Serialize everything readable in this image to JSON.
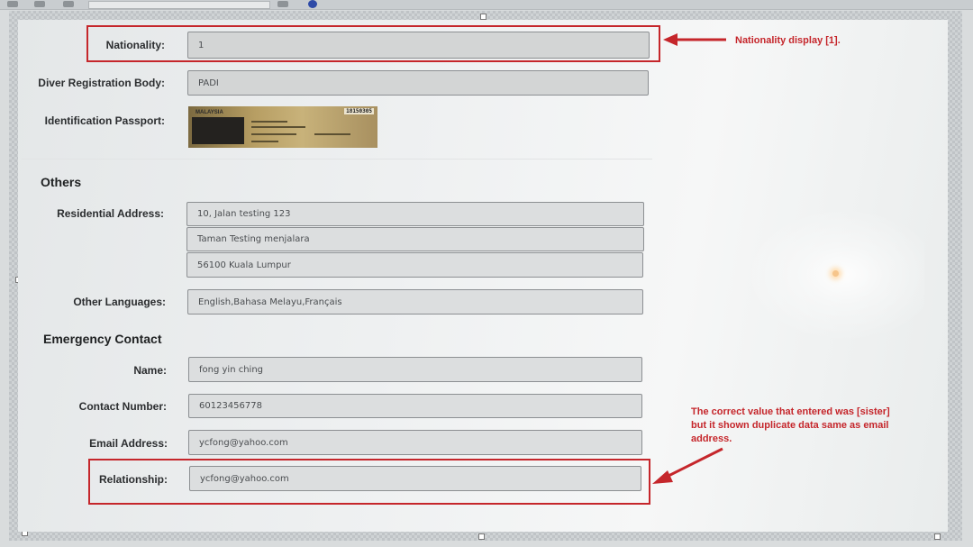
{
  "colors": {
    "annotation_red": "#c5262b",
    "field_bg": "#d3d5d5",
    "field_border": "#8c8f92",
    "page_bg": "#eef0f1"
  },
  "profile": {
    "nationality": {
      "label": "Nationality:",
      "value": "1"
    },
    "diver_registration_body": {
      "label": "Diver Registration Body:",
      "value": "PADI"
    },
    "identification_passport": {
      "label": "Identification Passport:",
      "image_text": "MALAYSIA",
      "image_number": "18150305"
    }
  },
  "others": {
    "title": "Others",
    "residential_address": {
      "label": "Residential Address:",
      "lines": [
        "10, Jalan testing 123",
        "Taman Testing menjalara",
        "56100 Kuala Lumpur"
      ]
    },
    "other_languages": {
      "label": "Other Languages:",
      "value": "English,Bahasa Melayu,Français"
    }
  },
  "emergency_contact": {
    "title": "Emergency Contact",
    "name": {
      "label": "Name:",
      "value": "fong yin ching"
    },
    "contact_number": {
      "label": "Contact Number:",
      "value": "60123456778"
    },
    "email_address": {
      "label": "Email Address:",
      "value": "ycfong@yahoo.com"
    },
    "relationship": {
      "label": "Relationship:",
      "value": "ycfong@yahoo.com"
    }
  },
  "annotations": {
    "nationality_note": "Nationality display [1].",
    "relationship_note_lines": [
      "The correct value that entered was [sister]",
      "but it shown duplicate data same as email",
      "address."
    ]
  },
  "icons": {
    "toolbar": [
      "menu-icon",
      "folder-icon",
      "app-icon"
    ]
  }
}
